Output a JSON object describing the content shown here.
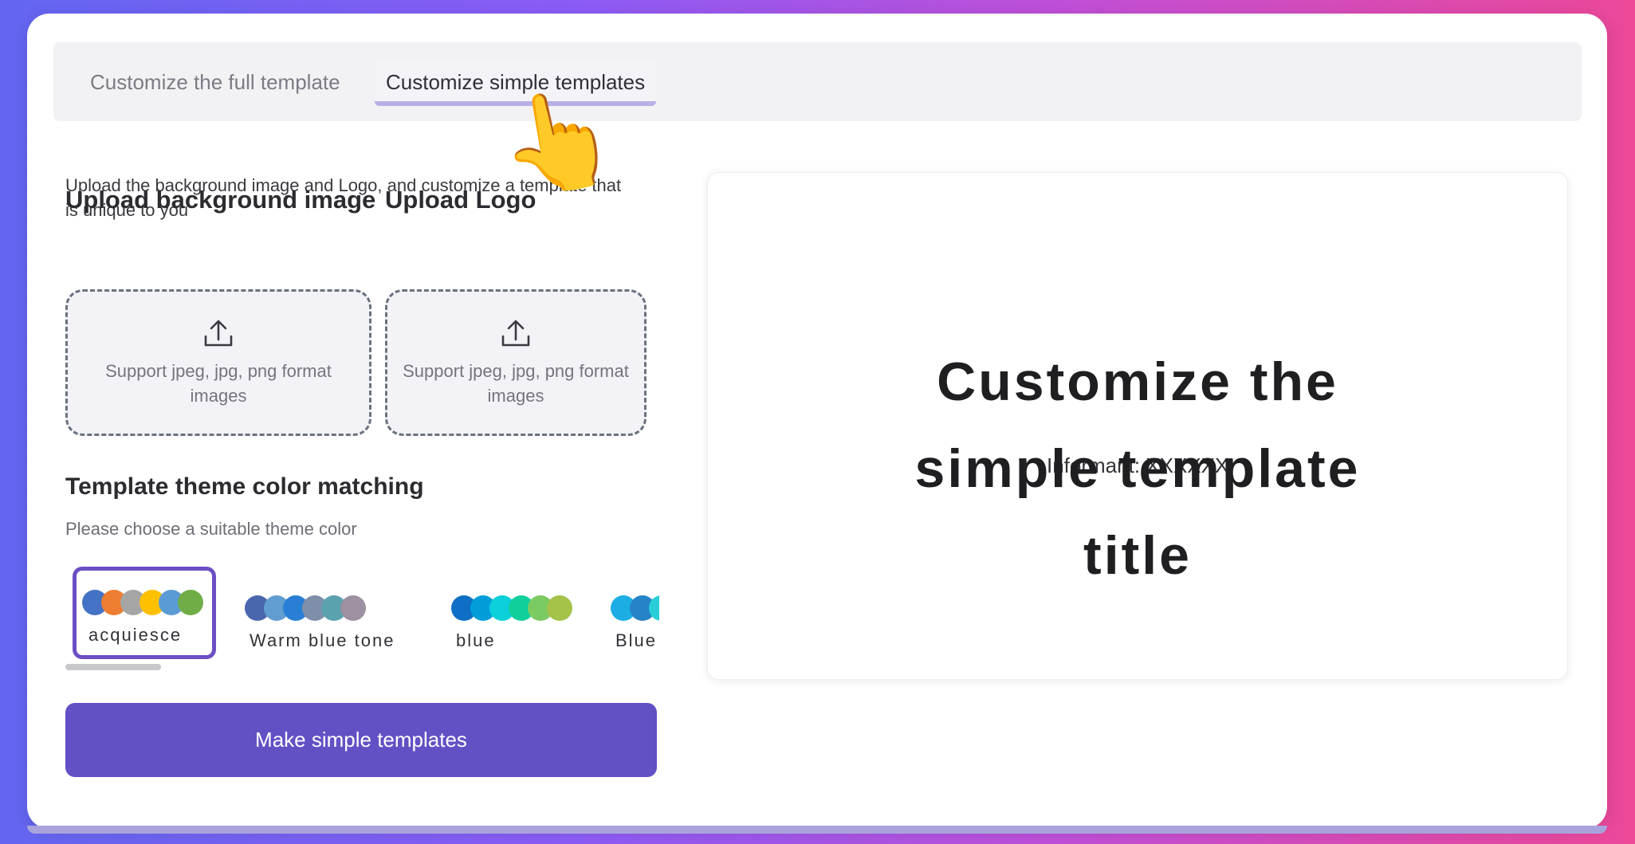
{
  "tabs": {
    "full_label": "Customize the full template",
    "simple_label": "Customize simple templates",
    "active": "simple"
  },
  "intro_text": "Upload the background image and Logo, and customize a template that is unique to you",
  "upload_background": {
    "heading": "Upload background image",
    "support_text": "Support jpeg, jpg, png format images",
    "icon": "upload-icon"
  },
  "upload_logo": {
    "heading": "Upload Logo",
    "support_text": "Support jpeg, jpg, png format images",
    "icon": "upload-icon"
  },
  "theme": {
    "heading": "Template theme color matching",
    "subtitle": "Please choose a suitable theme color",
    "options": [
      {
        "label": "acquiesce",
        "selected": true,
        "colors": [
          "#4472c4",
          "#ed7d31",
          "#a5a5a5",
          "#ffc000",
          "#5b9bd5",
          "#70ad47"
        ]
      },
      {
        "label": "Warm blue tone",
        "selected": false,
        "colors": [
          "#4a66ac",
          "#629dd1",
          "#297fd5",
          "#7f8fa9",
          "#5aa2ae",
          "#9d90a0"
        ]
      },
      {
        "label": "blue",
        "selected": false,
        "colors": [
          "#0f6fc6",
          "#009dd9",
          "#0bd0d9",
          "#10cf9b",
          "#7cca62",
          "#a5c249"
        ]
      },
      {
        "label": "Blue",
        "selected": false,
        "colors": [
          "#1cade4",
          "#2683c6",
          "#27ced7",
          "#42ba97",
          "#3e8853",
          "#62a39f"
        ]
      }
    ]
  },
  "make_button_label": "Make simple templates",
  "preview": {
    "title_lines": [
      "Customize the",
      "simple template",
      "title"
    ],
    "info_text": "Informant: XXXXXX"
  },
  "colors": {
    "accent": "#6250c5",
    "selected_border": "#6c4fc4"
  }
}
